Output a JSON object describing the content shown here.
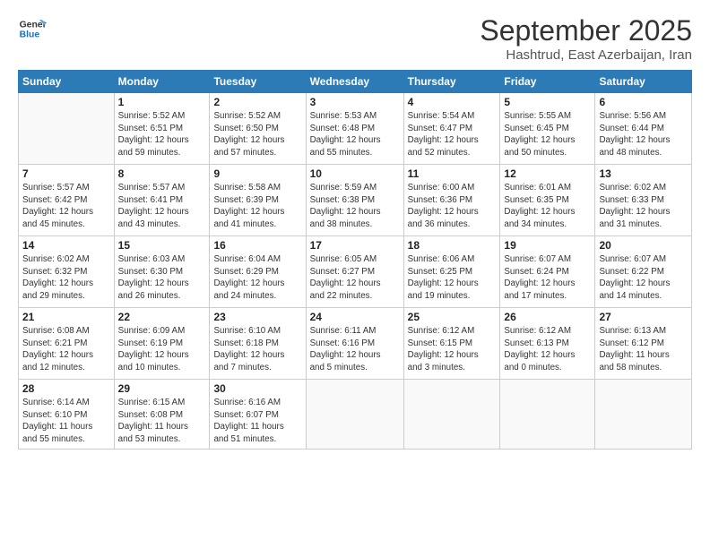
{
  "logo": {
    "line1": "General",
    "line2": "Blue"
  },
  "title": "September 2025",
  "subtitle": "Hashtrud, East Azerbaijan, Iran",
  "days_header": [
    "Sunday",
    "Monday",
    "Tuesday",
    "Wednesday",
    "Thursday",
    "Friday",
    "Saturday"
  ],
  "weeks": [
    [
      {
        "day": "",
        "info": ""
      },
      {
        "day": "1",
        "info": "Sunrise: 5:52 AM\nSunset: 6:51 PM\nDaylight: 12 hours\nand 59 minutes."
      },
      {
        "day": "2",
        "info": "Sunrise: 5:52 AM\nSunset: 6:50 PM\nDaylight: 12 hours\nand 57 minutes."
      },
      {
        "day": "3",
        "info": "Sunrise: 5:53 AM\nSunset: 6:48 PM\nDaylight: 12 hours\nand 55 minutes."
      },
      {
        "day": "4",
        "info": "Sunrise: 5:54 AM\nSunset: 6:47 PM\nDaylight: 12 hours\nand 52 minutes."
      },
      {
        "day": "5",
        "info": "Sunrise: 5:55 AM\nSunset: 6:45 PM\nDaylight: 12 hours\nand 50 minutes."
      },
      {
        "day": "6",
        "info": "Sunrise: 5:56 AM\nSunset: 6:44 PM\nDaylight: 12 hours\nand 48 minutes."
      }
    ],
    [
      {
        "day": "7",
        "info": "Sunrise: 5:57 AM\nSunset: 6:42 PM\nDaylight: 12 hours\nand 45 minutes."
      },
      {
        "day": "8",
        "info": "Sunrise: 5:57 AM\nSunset: 6:41 PM\nDaylight: 12 hours\nand 43 minutes."
      },
      {
        "day": "9",
        "info": "Sunrise: 5:58 AM\nSunset: 6:39 PM\nDaylight: 12 hours\nand 41 minutes."
      },
      {
        "day": "10",
        "info": "Sunrise: 5:59 AM\nSunset: 6:38 PM\nDaylight: 12 hours\nand 38 minutes."
      },
      {
        "day": "11",
        "info": "Sunrise: 6:00 AM\nSunset: 6:36 PM\nDaylight: 12 hours\nand 36 minutes."
      },
      {
        "day": "12",
        "info": "Sunrise: 6:01 AM\nSunset: 6:35 PM\nDaylight: 12 hours\nand 34 minutes."
      },
      {
        "day": "13",
        "info": "Sunrise: 6:02 AM\nSunset: 6:33 PM\nDaylight: 12 hours\nand 31 minutes."
      }
    ],
    [
      {
        "day": "14",
        "info": "Sunrise: 6:02 AM\nSunset: 6:32 PM\nDaylight: 12 hours\nand 29 minutes."
      },
      {
        "day": "15",
        "info": "Sunrise: 6:03 AM\nSunset: 6:30 PM\nDaylight: 12 hours\nand 26 minutes."
      },
      {
        "day": "16",
        "info": "Sunrise: 6:04 AM\nSunset: 6:29 PM\nDaylight: 12 hours\nand 24 minutes."
      },
      {
        "day": "17",
        "info": "Sunrise: 6:05 AM\nSunset: 6:27 PM\nDaylight: 12 hours\nand 22 minutes."
      },
      {
        "day": "18",
        "info": "Sunrise: 6:06 AM\nSunset: 6:25 PM\nDaylight: 12 hours\nand 19 minutes."
      },
      {
        "day": "19",
        "info": "Sunrise: 6:07 AM\nSunset: 6:24 PM\nDaylight: 12 hours\nand 17 minutes."
      },
      {
        "day": "20",
        "info": "Sunrise: 6:07 AM\nSunset: 6:22 PM\nDaylight: 12 hours\nand 14 minutes."
      }
    ],
    [
      {
        "day": "21",
        "info": "Sunrise: 6:08 AM\nSunset: 6:21 PM\nDaylight: 12 hours\nand 12 minutes."
      },
      {
        "day": "22",
        "info": "Sunrise: 6:09 AM\nSunset: 6:19 PM\nDaylight: 12 hours\nand 10 minutes."
      },
      {
        "day": "23",
        "info": "Sunrise: 6:10 AM\nSunset: 6:18 PM\nDaylight: 12 hours\nand 7 minutes."
      },
      {
        "day": "24",
        "info": "Sunrise: 6:11 AM\nSunset: 6:16 PM\nDaylight: 12 hours\nand 5 minutes."
      },
      {
        "day": "25",
        "info": "Sunrise: 6:12 AM\nSunset: 6:15 PM\nDaylight: 12 hours\nand 3 minutes."
      },
      {
        "day": "26",
        "info": "Sunrise: 6:12 AM\nSunset: 6:13 PM\nDaylight: 12 hours\nand 0 minutes."
      },
      {
        "day": "27",
        "info": "Sunrise: 6:13 AM\nSunset: 6:12 PM\nDaylight: 11 hours\nand 58 minutes."
      }
    ],
    [
      {
        "day": "28",
        "info": "Sunrise: 6:14 AM\nSunset: 6:10 PM\nDaylight: 11 hours\nand 55 minutes."
      },
      {
        "day": "29",
        "info": "Sunrise: 6:15 AM\nSunset: 6:08 PM\nDaylight: 11 hours\nand 53 minutes."
      },
      {
        "day": "30",
        "info": "Sunrise: 6:16 AM\nSunset: 6:07 PM\nDaylight: 11 hours\nand 51 minutes."
      },
      {
        "day": "",
        "info": ""
      },
      {
        "day": "",
        "info": ""
      },
      {
        "day": "",
        "info": ""
      },
      {
        "day": "",
        "info": ""
      }
    ]
  ]
}
